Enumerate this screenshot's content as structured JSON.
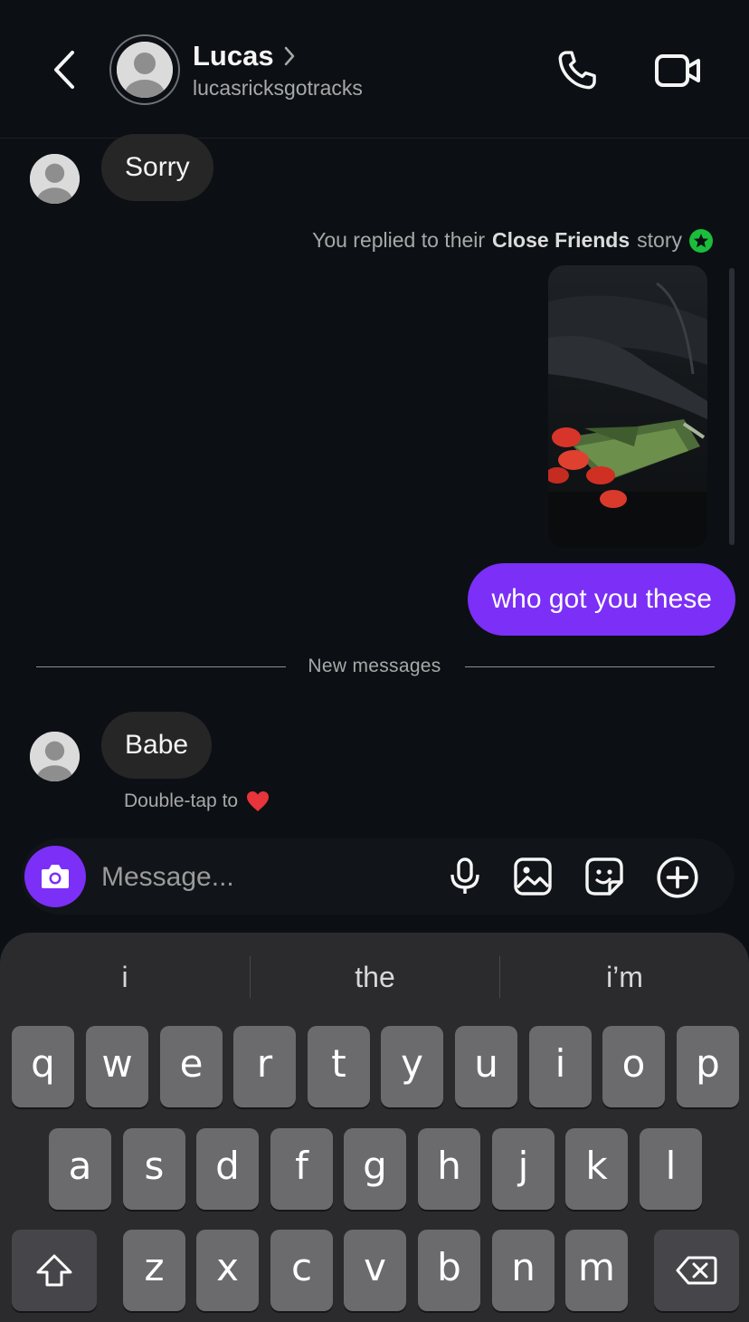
{
  "header": {
    "contact_name": "Lucas",
    "name_chevron": "›",
    "username": "lucasricksgotracks"
  },
  "messages": {
    "incoming_1": "Sorry",
    "story_reply_prefix": "You replied to their",
    "story_reply_bold": "Close Friends",
    "story_reply_suffix": "story",
    "outgoing_1": "who got you these",
    "new_messages_label": "New messages",
    "incoming_2": "Babe",
    "reaction_hint": "Double-tap to",
    "reaction_emoji": "❤️"
  },
  "composer": {
    "placeholder": "Message..."
  },
  "keyboard": {
    "suggestions": [
      "i",
      "the",
      "i’m"
    ],
    "row1": [
      "q",
      "w",
      "e",
      "r",
      "t",
      "y",
      "u",
      "i",
      "o",
      "p"
    ],
    "row2": [
      "a",
      "s",
      "d",
      "f",
      "g",
      "h",
      "j",
      "k",
      "l"
    ],
    "row3": [
      "z",
      "x",
      "c",
      "v",
      "b",
      "n",
      "m"
    ]
  },
  "colors": {
    "accent": "#7b2ff7",
    "close_friends_green": "#1bbd3a",
    "background": "#0c1014"
  },
  "icons": [
    "back-arrow-icon",
    "chevron-right-icon",
    "phone-icon",
    "video-camera-icon",
    "camera-icon",
    "microphone-icon",
    "gallery-icon",
    "sticker-icon",
    "plus-circle-icon",
    "shift-icon",
    "backspace-icon"
  ]
}
